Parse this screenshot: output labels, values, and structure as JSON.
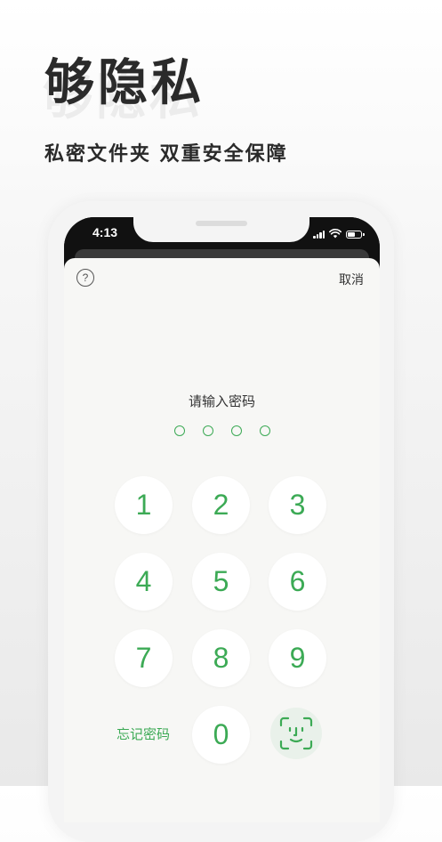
{
  "promo": {
    "headline": "够隐私",
    "subhead": "私密文件夹 双重安全保障"
  },
  "status_bar": {
    "time": "4:13",
    "icons": [
      "signal-icon",
      "wifi-icon",
      "battery-icon"
    ]
  },
  "modal": {
    "help_label": "?",
    "cancel_label": "取消",
    "prompt": "请输入密码",
    "pin_length": 4,
    "keypad": {
      "keys": [
        "1",
        "2",
        "3",
        "4",
        "5",
        "6",
        "7",
        "8",
        "9",
        "0"
      ],
      "forgot_label": "忘记密码",
      "faceid_icon": "face-id-icon"
    }
  },
  "colors": {
    "accent": "#3caa55",
    "modal_bg": "#f7f7f5",
    "headline": "#2a2a2a"
  }
}
